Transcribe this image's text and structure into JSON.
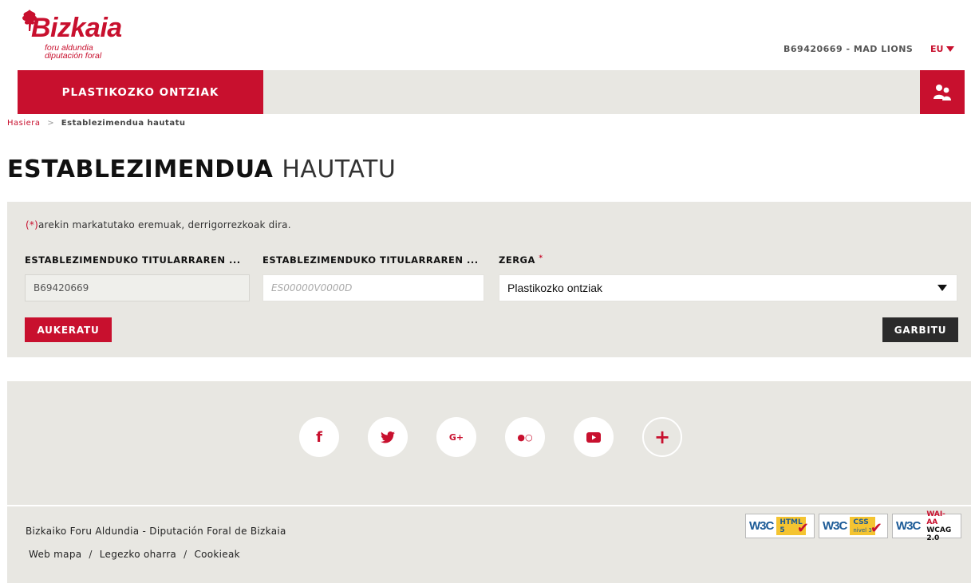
{
  "header": {
    "logo_text": "Bizkaia",
    "logo_sub1": "foru aldundia",
    "logo_sub2": "diputación foral",
    "user_code": "B69420669 - MAD LIONS",
    "language": "EU",
    "section_title": "PLASTIKOZKO ONTZIAK",
    "users_icon": "users-icon"
  },
  "breadcrumb": {
    "home": "Hasiera",
    "separator": ">",
    "current": "Establezimendua hautatu"
  },
  "page": {
    "title_strong": "ESTABLEZIMENDUA",
    "title_light": "HAUTATU"
  },
  "form": {
    "required_mark": "(*)",
    "required_note": "arekin markatutako eremuak, derrigorrezkoak dira.",
    "fields": [
      {
        "label": "ESTABLEZIMENDUKO TITULARRAREN ...",
        "value": "B69420669",
        "placeholder": ""
      },
      {
        "label": "ESTABLEZIMENDUKO TITULARRAREN ...",
        "value": "",
        "placeholder": "ES00000V0000D"
      },
      {
        "label": "ZERGA",
        "required": "*",
        "value": "Plastikozko ontziak"
      }
    ],
    "submit_label": "AUKERATU",
    "clear_label": "GARBITU"
  },
  "footer": {
    "social": [
      {
        "name": "facebook-icon",
        "glyph": "f"
      },
      {
        "name": "twitter-icon",
        "glyph": "🐦"
      },
      {
        "name": "google-plus-icon",
        "glyph": "G+"
      },
      {
        "name": "flickr-icon",
        "glyph": "●○"
      },
      {
        "name": "youtube-icon",
        "glyph": "▶"
      },
      {
        "name": "plus-icon",
        "glyph": "+"
      }
    ],
    "org_name": "Bizkaiko Foru Aldundia - Diputación Foral de Bizkaia",
    "links": [
      "Web mapa",
      "Legezko oharra",
      "Cookieak"
    ],
    "link_separator": "/",
    "badges": [
      {
        "prefix": "W3C",
        "line1": "HTML",
        "line2": "5"
      },
      {
        "prefix": "W3C",
        "line1": "CSS",
        "line2": "nivel 3"
      },
      {
        "prefix": "W3C",
        "line1": "WAI-AA",
        "line2": "WCAG 2.0"
      }
    ]
  },
  "colors": {
    "brand_red": "#c8102e",
    "panel_gray": "#e8e7e2",
    "dark_button": "#2b2b2b"
  }
}
